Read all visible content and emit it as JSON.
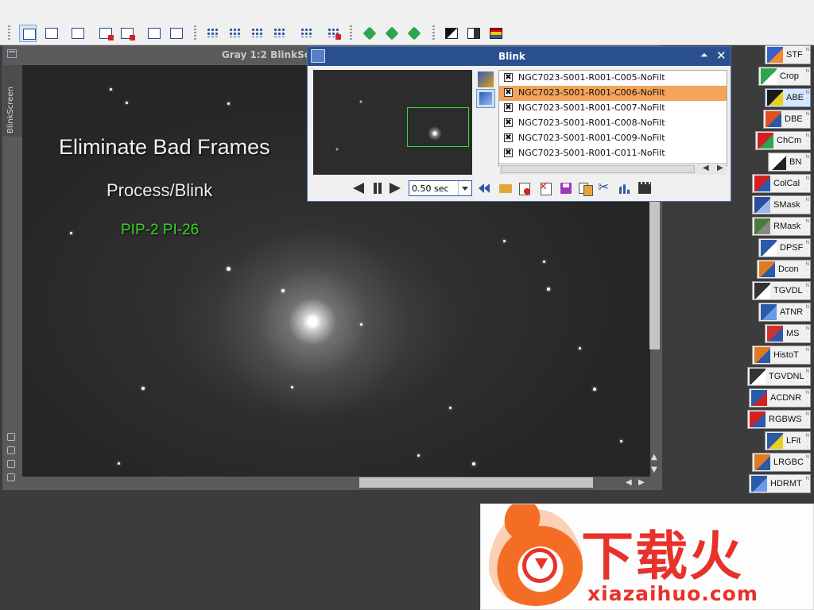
{
  "image_window": {
    "title": "Gray 1:2 BlinkSc",
    "side_tab": "BlinkScreen",
    "overlay": {
      "title": "Eliminate Bad Frames",
      "subtitle": "Process/Blink",
      "tag": "PIP-2 PI-26"
    }
  },
  "blink": {
    "title": "Blink",
    "files": [
      {
        "name": "NGC7023-S001-R001-C005-NoFilt",
        "checked": true,
        "selected": false
      },
      {
        "name": "NGC7023-S001-R001-C006-NoFilt",
        "checked": true,
        "selected": true
      },
      {
        "name": "NGC7023-S001-R001-C007-NoFilt",
        "checked": true,
        "selected": false
      },
      {
        "name": "NGC7023-S001-R001-C008-NoFilt",
        "checked": true,
        "selected": false
      },
      {
        "name": "NGC7023-S001-R001-C009-NoFilt",
        "checked": true,
        "selected": false
      },
      {
        "name": "NGC7023-S001-R001-C011-NoFilt",
        "checked": true,
        "selected": false
      }
    ],
    "check_mark": "✖",
    "speed": "0.50 sec"
  },
  "process_icons": [
    {
      "label": "STF",
      "colors": [
        "#3a5fc8",
        "#f08a2a"
      ]
    },
    {
      "label": "Crop",
      "colors": [
        "#2ea44f",
        "#ffffff"
      ]
    },
    {
      "label": "ABE",
      "colors": [
        "#1a1a1a",
        "#e8d020"
      ],
      "active": true
    },
    {
      "label": "DBE",
      "colors": [
        "#e05020",
        "#2a5aa8"
      ]
    },
    {
      "label": "ChCm",
      "colors": [
        "#d42020",
        "#2ea44f"
      ]
    },
    {
      "label": "BN",
      "colors": [
        "#ffffff",
        "#222222"
      ]
    },
    {
      "label": "ColCal",
      "colors": [
        "#d42020",
        "#2a5aa8"
      ]
    },
    {
      "label": "SMask",
      "colors": [
        "#2a4fa0",
        "#9fb6e6"
      ]
    },
    {
      "label": "RMask",
      "colors": [
        "#4a7a3a",
        "#888888"
      ]
    },
    {
      "label": "DPSF",
      "colors": [
        "#2a5aa8",
        "#ffffff"
      ]
    },
    {
      "label": "Dcon",
      "colors": [
        "#e07a20",
        "#2a5aa8"
      ]
    },
    {
      "label": "TGVDL",
      "colors": [
        "#333333",
        "#ffffff"
      ]
    },
    {
      "label": "ATNR",
      "colors": [
        "#2a5aa8",
        "#6b9ae6"
      ]
    },
    {
      "label": "MS",
      "colors": [
        "#cc3333",
        "#3355aa"
      ]
    },
    {
      "label": "HistoT",
      "colors": [
        "#e07a20",
        "#2a5aa8"
      ]
    },
    {
      "label": "TGVDNL",
      "colors": [
        "#333333",
        "#ffffff"
      ]
    },
    {
      "label": "ACDNR",
      "colors": [
        "#2a5aa8",
        "#d42020"
      ]
    },
    {
      "label": "RGBWS",
      "colors": [
        "#d42020",
        "#2a5aa8"
      ]
    },
    {
      "label": "LFit",
      "colors": [
        "#2a5aa8",
        "#e8d020"
      ]
    },
    {
      "label": "LRGBC",
      "colors": [
        "#e07a20",
        "#2a5aa8"
      ]
    },
    {
      "label": "HDRMT",
      "colors": [
        "#2a5aa8",
        "#6b9ae6"
      ]
    }
  ],
  "watermark": {
    "text": "下载火",
    "url": "xiazaihuo.com"
  },
  "colors": {
    "accent": "#2a4f8e",
    "selection": "#f3a35a",
    "overlay_tag": "#39d42a"
  }
}
